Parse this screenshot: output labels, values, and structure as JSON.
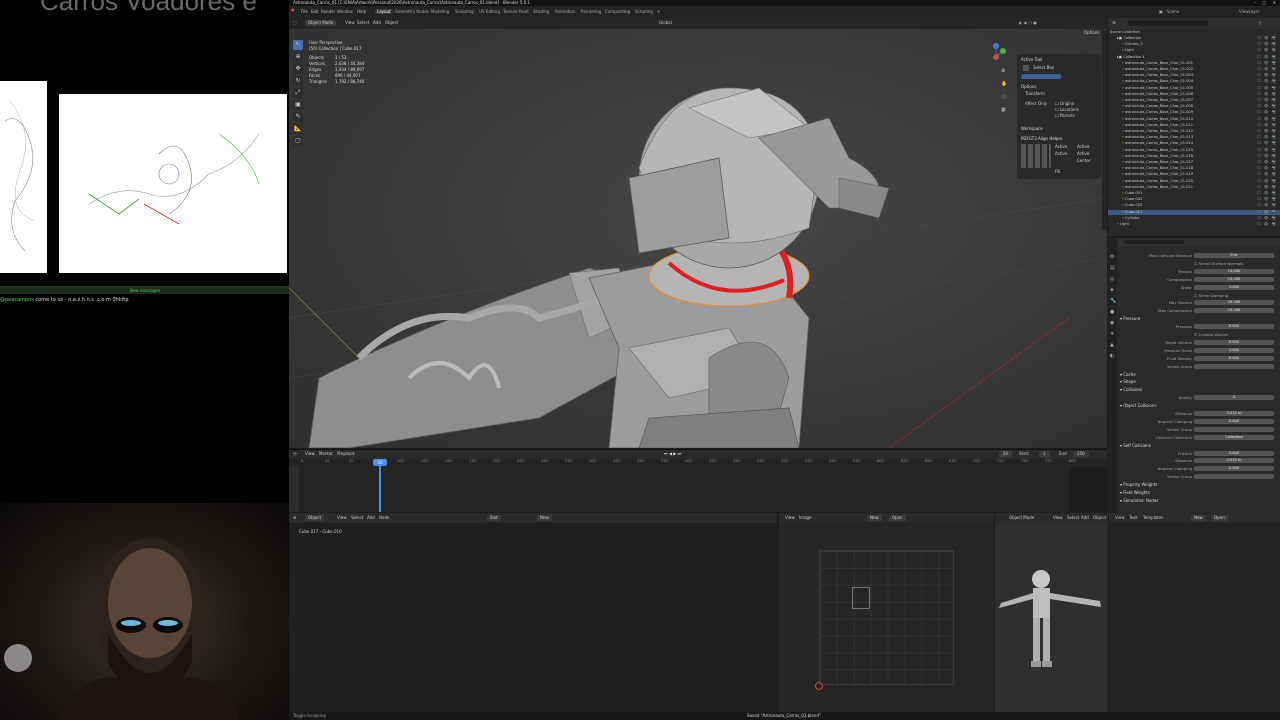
{
  "stream": {
    "title": "Carros Voadores e",
    "chat": {
      "new_messages": "New messages",
      "user": "@peacampos",
      "message": "come to us - n.e.z.h.n.s .c.o.m 0hkftp"
    }
  },
  "blender": {
    "window_title": "Astronauta_Carros_01 [C:\\ENIA\\Artwork\\Personal\\2026\\Astronauta_Carros\\Astronauta_Carros_01.blend] - Blender 5.0.1",
    "menu": [
      "File",
      "Edit",
      "Render",
      "Window",
      "Help"
    ],
    "workspaces": [
      "Layout",
      "Geometry Nodes",
      "Modeling",
      "Sculpting",
      "UV Editing",
      "Texture Paint",
      "Shading",
      "Animation",
      "Rendering",
      "Compositing",
      "Scripting"
    ],
    "active_workspace": "Layout",
    "scene": "Scene",
    "view_layer": "ViewLayer",
    "viewport": {
      "mode": "Object Mode",
      "header_menus": [
        "View",
        "Select",
        "Add",
        "Object"
      ],
      "transform": "Global",
      "options": "Options",
      "perspective": "User Perspective",
      "context": "(50) Collection | Cube.017",
      "stats": [
        {
          "label": "Objects",
          "value": "1 / 52"
        },
        {
          "label": "Vertices",
          "value": "2,038 / 44,384"
        },
        {
          "label": "Edges",
          "value": "1,934 / 89,697"
        },
        {
          "label": "Faces",
          "value": "896 / 44,907"
        },
        {
          "label": "Triangles",
          "value": "1,792 / 88,740"
        }
      ],
      "npanel": {
        "active_tool": "Active Tool",
        "tool_name": "Select Box",
        "options": "Options",
        "transform": "Transform",
        "affect_only": "Affect Only",
        "affect_items": [
          "Origins",
          "Locations",
          "Parents"
        ],
        "workspace": "Workspace",
        "addon": "PDFGT3 Align Helper",
        "addon_buttons": [
          "Active",
          "Active",
          "Active",
          "Active",
          "Center"
        ],
        "fill": "Fill"
      }
    },
    "timeline": {
      "menus": [
        "View",
        "Marker",
        "Playback"
      ],
      "current_frame": "50",
      "frame_display": "50",
      "start_label": "Start",
      "start": "1",
      "end_label": "End",
      "end": "250",
      "ticks": [
        "0",
        "25",
        "50",
        "75",
        "100",
        "125",
        "150",
        "175",
        "200",
        "225",
        "250",
        "275",
        "300",
        "325",
        "350",
        "375",
        "400",
        "425",
        "450",
        "475",
        "500",
        "525",
        "550",
        "575",
        "600",
        "625",
        "650",
        "675",
        "700",
        "725",
        "750",
        "775",
        "800"
      ]
    },
    "outliner": {
      "scene_collection": "Scene Collection",
      "rows": [
        {
          "name": "Collection",
          "depth": 1,
          "selected": false
        },
        {
          "name": "Cilindro_3",
          "depth": 2,
          "selected": false
        },
        {
          "name": "Light",
          "depth": 2,
          "selected": false
        },
        {
          "name": "Collection 4",
          "depth": 1,
          "selected": false
        },
        {
          "name": "astronauta_Carros_Base_Char_01.001",
          "depth": 2,
          "selected": false
        },
        {
          "name": "astronauta_Carros_Base_Char_01.002",
          "depth": 2,
          "selected": false
        },
        {
          "name": "astronauta_Carros_Base_Char_01.003",
          "depth": 2,
          "selected": false
        },
        {
          "name": "astronauta_Carros_Base_Char_01.004",
          "depth": 2,
          "selected": false
        },
        {
          "name": "astronauta_Carros_Base_Char_01.005",
          "depth": 2,
          "selected": false
        },
        {
          "name": "astronauta_Carros_Base_Char_01.006",
          "depth": 2,
          "selected": false
        },
        {
          "name": "astronauta_Carros_Base_Char_01.007",
          "depth": 2,
          "selected": false
        },
        {
          "name": "astronauta_Carros_Base_Char_01.008",
          "depth": 2,
          "selected": false
        },
        {
          "name": "astronauta_Carros_Base_Char_01.009",
          "depth": 2,
          "selected": false
        },
        {
          "name": "astronauta_Carros_Base_Char_01.010",
          "depth": 2,
          "selected": false
        },
        {
          "name": "astronauta_Carros_Base_Char_01.011",
          "depth": 2,
          "selected": false
        },
        {
          "name": "astronauta_Carros_Base_Char_01.012",
          "depth": 2,
          "selected": false
        },
        {
          "name": "astronauta_Carros_Base_Char_01.013",
          "depth": 2,
          "selected": false
        },
        {
          "name": "astronauta_Carros_Base_Char_01.014",
          "depth": 2,
          "selected": false
        },
        {
          "name": "astronauta_Carros_Base_Char_01.015",
          "depth": 2,
          "selected": false
        },
        {
          "name": "astronauta_Carros_Base_Char_01.016",
          "depth": 2,
          "selected": false
        },
        {
          "name": "astronauta_Carros_Base_Char_01.017",
          "depth": 2,
          "selected": false
        },
        {
          "name": "astronauta_Carros_Base_Char_01.018",
          "depth": 2,
          "selected": false
        },
        {
          "name": "astronauta_Carros_Base_Char_01.019",
          "depth": 2,
          "selected": false
        },
        {
          "name": "astronauta_Carros_Base_Char_01.020",
          "depth": 2,
          "selected": false
        },
        {
          "name": "astronauta_Carros_Base_Char_01.021",
          "depth": 2,
          "selected": false
        },
        {
          "name": "Cube.001",
          "depth": 2,
          "selected": false
        },
        {
          "name": "Cube.002",
          "depth": 2,
          "selected": false
        },
        {
          "name": "Cube.003",
          "depth": 2,
          "selected": false
        },
        {
          "name": "Cube.017",
          "depth": 2,
          "selected": true
        },
        {
          "name": "Cylinder",
          "depth": 2,
          "selected": false
        },
        {
          "name": "Light",
          "depth": 1,
          "selected": false
        }
      ]
    },
    "properties": {
      "rows": [
        {
          "type": "field",
          "label": "Max Collision Distance",
          "value": "0 m"
        },
        {
          "type": "check",
          "label": "Shrink Surface Normals"
        },
        {
          "type": "field",
          "label": "Tension",
          "value": "15.000"
        },
        {
          "type": "field",
          "label": "Compression",
          "value": "15.000"
        },
        {
          "type": "field",
          "label": "Shear",
          "value": "5.000"
        },
        {
          "type": "check",
          "label": "Shear Damping"
        },
        {
          "type": "field",
          "label": "Max Tension",
          "value": "15.000"
        },
        {
          "type": "field",
          "label": "Max Compression",
          "value": "15.000"
        },
        {
          "type": "section",
          "label": "Pressure"
        },
        {
          "type": "field",
          "label": "Pressure",
          "value": "0.000"
        },
        {
          "type": "check",
          "label": "Custom Volume"
        },
        {
          "type": "field",
          "label": "Target Volume",
          "value": "0.000"
        },
        {
          "type": "field",
          "label": "Pressure Scale",
          "value": "1.000"
        },
        {
          "type": "field",
          "label": "Fluid Density",
          "value": "0.000"
        },
        {
          "type": "field",
          "label": "Vertex Group",
          "value": ""
        },
        {
          "type": "section",
          "label": "Cache"
        },
        {
          "type": "section",
          "label": "Shape"
        },
        {
          "type": "section",
          "label": "Collisions"
        },
        {
          "type": "field",
          "label": "Quality",
          "value": "2"
        },
        {
          "type": "section",
          "label": "Object Collisions"
        },
        {
          "type": "field",
          "label": "Distance",
          "value": "0.015 m"
        },
        {
          "type": "field",
          "label": "Impulse Clamping",
          "value": "0.000"
        },
        {
          "type": "field",
          "label": "Vertex Group",
          "value": ""
        },
        {
          "type": "field",
          "label": "Collision Collection",
          "value": "Collection"
        },
        {
          "type": "section",
          "label": "Self Collisions"
        },
        {
          "type": "field",
          "label": "Friction",
          "value": "5.000"
        },
        {
          "type": "field",
          "label": "Distance",
          "value": "0.015 m"
        },
        {
          "type": "field",
          "label": "Impulse Clamping",
          "value": "0.000"
        },
        {
          "type": "field",
          "label": "Vertex Group",
          "value": ""
        },
        {
          "type": "section",
          "label": "Property Weights"
        },
        {
          "type": "section",
          "label": "Field Weights"
        },
        {
          "type": "section",
          "label": "Simulation Nodes"
        }
      ]
    },
    "node_editor": {
      "type": "Object",
      "menus": [
        "View",
        "Select",
        "Add",
        "Node"
      ],
      "slot": "Slot",
      "new": "New",
      "breadcrumb": [
        "Cube.017",
        "Cube.010"
      ]
    },
    "uv_editor": {
      "menus": [
        "View",
        "Image"
      ],
      "new": "New",
      "open": "Open"
    },
    "preview": {
      "mode": "Object Mode",
      "menus": [
        "View",
        "Select",
        "Add",
        "Object"
      ]
    },
    "text_editor": {
      "menus": [
        "View",
        "Text",
        "Templates"
      ],
      "new": "New",
      "open": "Open"
    },
    "status_bar": {
      "left": "Toggle Snapping",
      "message": "Saved \"Astronauta_Carros_01.blend\""
    }
  },
  "colors": {
    "accent": "#4772b3",
    "selection_orange": "#e8902e",
    "highlight_red": "#e02020",
    "playhead": "#4a8fe8"
  }
}
